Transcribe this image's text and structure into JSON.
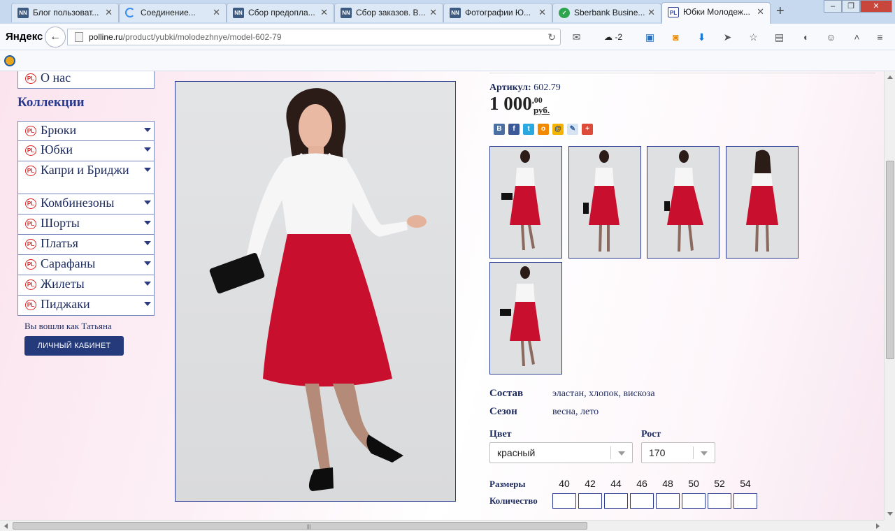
{
  "browser": {
    "tabs": [
      {
        "title": "Блог пользоват...",
        "icon": "nn-icon"
      },
      {
        "title": "Соединение...",
        "icon": "loading-icon"
      },
      {
        "title": "Сбор предопла...",
        "icon": "nn-icon"
      },
      {
        "title": "Сбор заказов. В...",
        "icon": "nn-icon"
      },
      {
        "title": "Фотографии Ю...",
        "icon": "nn-icon"
      },
      {
        "title": "Sberbank Busine...",
        "icon": "sberbank-icon"
      },
      {
        "title": "Юбки Молодеж...",
        "icon": "polline-icon",
        "active": true
      }
    ],
    "logo": "Яндекс",
    "url_host": "polline.ru",
    "url_path": "/product/yubki/molodezhnye/model-602-79",
    "weather_temp": "-2"
  },
  "sidebar": {
    "about": "О нас",
    "collections_title": "Коллекции",
    "items": [
      {
        "label": "Брюки"
      },
      {
        "label": "Юбки"
      },
      {
        "label": "Капри и Бриджи"
      },
      {
        "label": "Комбинезоны"
      },
      {
        "label": "Шорты"
      },
      {
        "label": "Платья"
      },
      {
        "label": "Сарафаны"
      },
      {
        "label": "Жилеты"
      },
      {
        "label": "Пиджаки"
      }
    ],
    "logged_in_text": "Вы вошли как Татьяна",
    "cabinet_button": "ЛИЧНЫЙ КАБИНЕТ"
  },
  "product": {
    "article_label": "Артикул:",
    "article": "602.79",
    "price_main": "1 000",
    "price_cents": ",00",
    "currency": "руб.",
    "composition_label": "Состав",
    "composition": "эластан, хлопок, вискоза",
    "season_label": "Сезон",
    "season": "весна, лето",
    "color_label": "Цвет",
    "color_value": "красный",
    "height_label": "Рост",
    "height_value": "170",
    "sizes_label": "Размеры",
    "quantity_label": "Количество",
    "sizes": [
      "40",
      "42",
      "44",
      "46",
      "48",
      "50",
      "52",
      "54"
    ],
    "skirt_color": "#c8102e",
    "blouse_color": "#f6f6f6"
  },
  "share_icons": [
    "vk-icon",
    "facebook-icon",
    "twitter-icon",
    "odnoklassniki-icon",
    "mailru-icon",
    "livejournal-icon",
    "googleplus-icon"
  ]
}
